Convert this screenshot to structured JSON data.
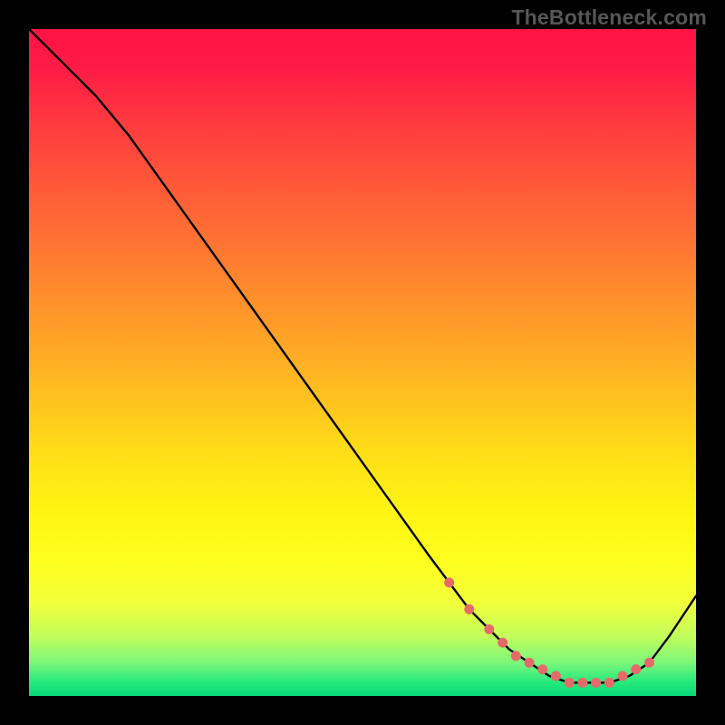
{
  "watermark": {
    "text": "TheBottleneck.com"
  },
  "chart_data": {
    "type": "line",
    "title": "",
    "xlabel": "",
    "ylabel": "",
    "xlim": [
      0,
      100
    ],
    "ylim": [
      0,
      100
    ],
    "series": [
      {
        "name": "curve",
        "x": [
          0,
          3,
          6,
          10,
          15,
          20,
          25,
          30,
          35,
          40,
          45,
          50,
          55,
          60,
          63,
          66,
          69,
          72,
          75,
          78,
          81,
          84,
          87,
          90,
          93,
          96,
          100
        ],
        "y": [
          100,
          97,
          94,
          90,
          84,
          77,
          70,
          63,
          56,
          49,
          42,
          35,
          28,
          21,
          17,
          13,
          10,
          7,
          5,
          3,
          2,
          2,
          2,
          3,
          5,
          9,
          15
        ]
      }
    ],
    "markers": {
      "name": "highlight-dots",
      "color": "#e76a6a",
      "x": [
        63,
        66,
        69,
        71,
        73,
        75,
        77,
        79,
        81,
        83,
        85,
        87,
        89,
        91,
        93
      ],
      "y": [
        17,
        13,
        10,
        8,
        6,
        5,
        4,
        3,
        2,
        2,
        2,
        2,
        3,
        4,
        5
      ]
    }
  }
}
